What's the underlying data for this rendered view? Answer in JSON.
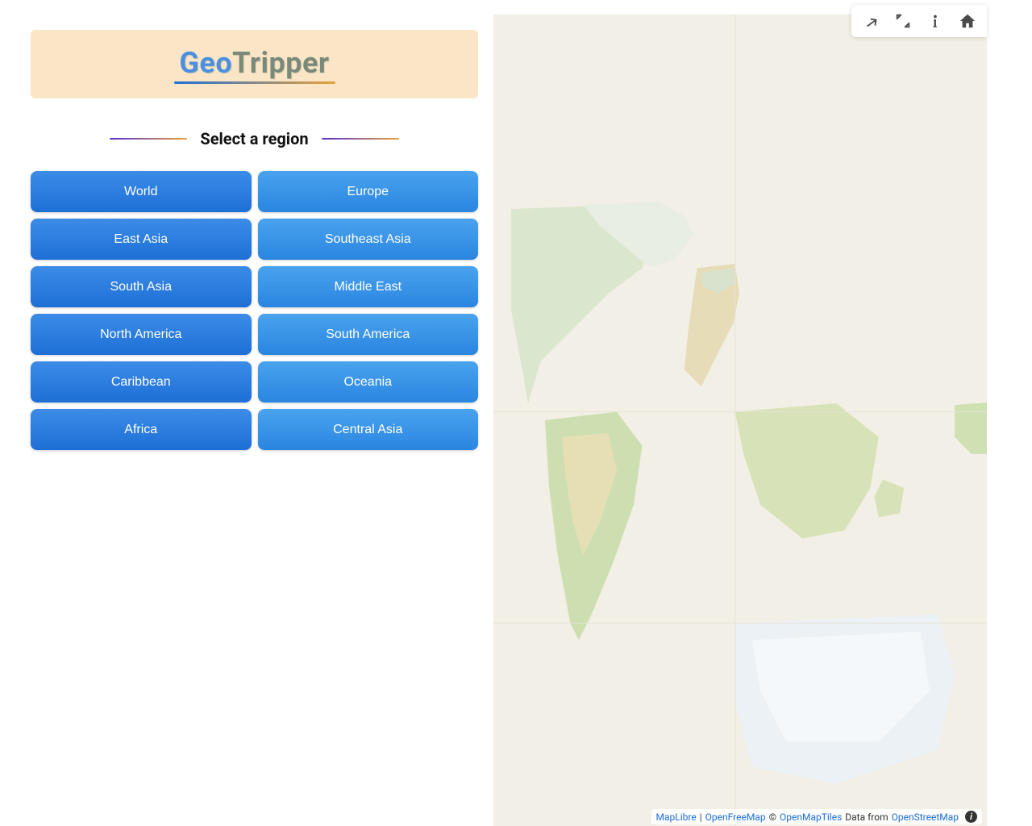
{
  "app": {
    "logo_part1": "Geo",
    "logo_part2": "Tripper"
  },
  "heading": "Select a region",
  "regions": [
    "World",
    "Europe",
    "East Asia",
    "Southeast Asia",
    "South Asia",
    "Middle East",
    "North America",
    "South America",
    "Caribbean",
    "Oceania",
    "Africa",
    "Central Asia"
  ],
  "toolbar": {
    "share": "share-icon",
    "fullscreen": "fullscreen-icon",
    "info": "info-icon",
    "home": "home-icon"
  },
  "attribution": {
    "maplibre": "MapLibre",
    "sep1": "|",
    "openfreemap": "OpenFreeMap",
    "copy": "©",
    "openmaptiles": "OpenMapTiles",
    "data_from": "Data from",
    "osm": "OpenStreetMap",
    "info_glyph": "i"
  }
}
